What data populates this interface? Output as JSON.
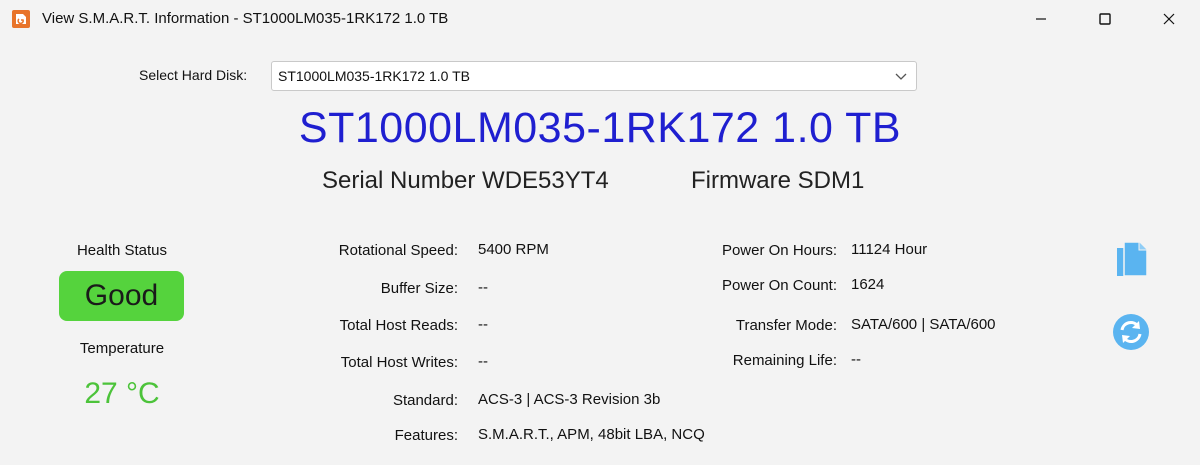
{
  "window": {
    "title": "View S.M.A.R.T. Information - ST1000LM035-1RK172 1.0 TB",
    "icon": "app-logo-icon"
  },
  "disk_select": {
    "label": "Select Hard Disk:",
    "value": "ST1000LM035-1RK172 1.0 TB"
  },
  "disk": {
    "title": "ST1000LM035-1RK172 1.0 TB",
    "serial": "Serial Number WDE53YT4",
    "firmware": "Firmware SDM1"
  },
  "health": {
    "label": "Health Status",
    "status": "Good",
    "status_color": "#55d33d",
    "temperature_label": "Temperature",
    "temperature": "27 °C",
    "temperature_color": "#4cc33a"
  },
  "info_left": [
    {
      "label": "Rotational Speed:",
      "value": "5400 RPM"
    },
    {
      "label": "Buffer Size:",
      "value": "--"
    },
    {
      "label": "Total Host Reads:",
      "value": "--"
    },
    {
      "label": "Total Host Writes:",
      "value": "--"
    },
    {
      "label": "Standard:",
      "value": "ACS-3 | ACS-3 Revision 3b"
    },
    {
      "label": "Features:",
      "value": "S.M.A.R.T., APM, 48bit LBA, NCQ"
    }
  ],
  "info_right": [
    {
      "label": "Power On Hours:",
      "value": "11124 Hour"
    },
    {
      "label": "Power On Count:",
      "value": "1624"
    },
    {
      "label": "Transfer Mode:",
      "value": "SATA/600 | SATA/600"
    },
    {
      "label": "Remaining Life:",
      "value": "--"
    }
  ],
  "actions": {
    "copy_icon": "copy-icon",
    "refresh_icon": "refresh-icon",
    "accent": "#5ab4f0"
  },
  "colors": {
    "title_blue": "#1f1fd0"
  }
}
